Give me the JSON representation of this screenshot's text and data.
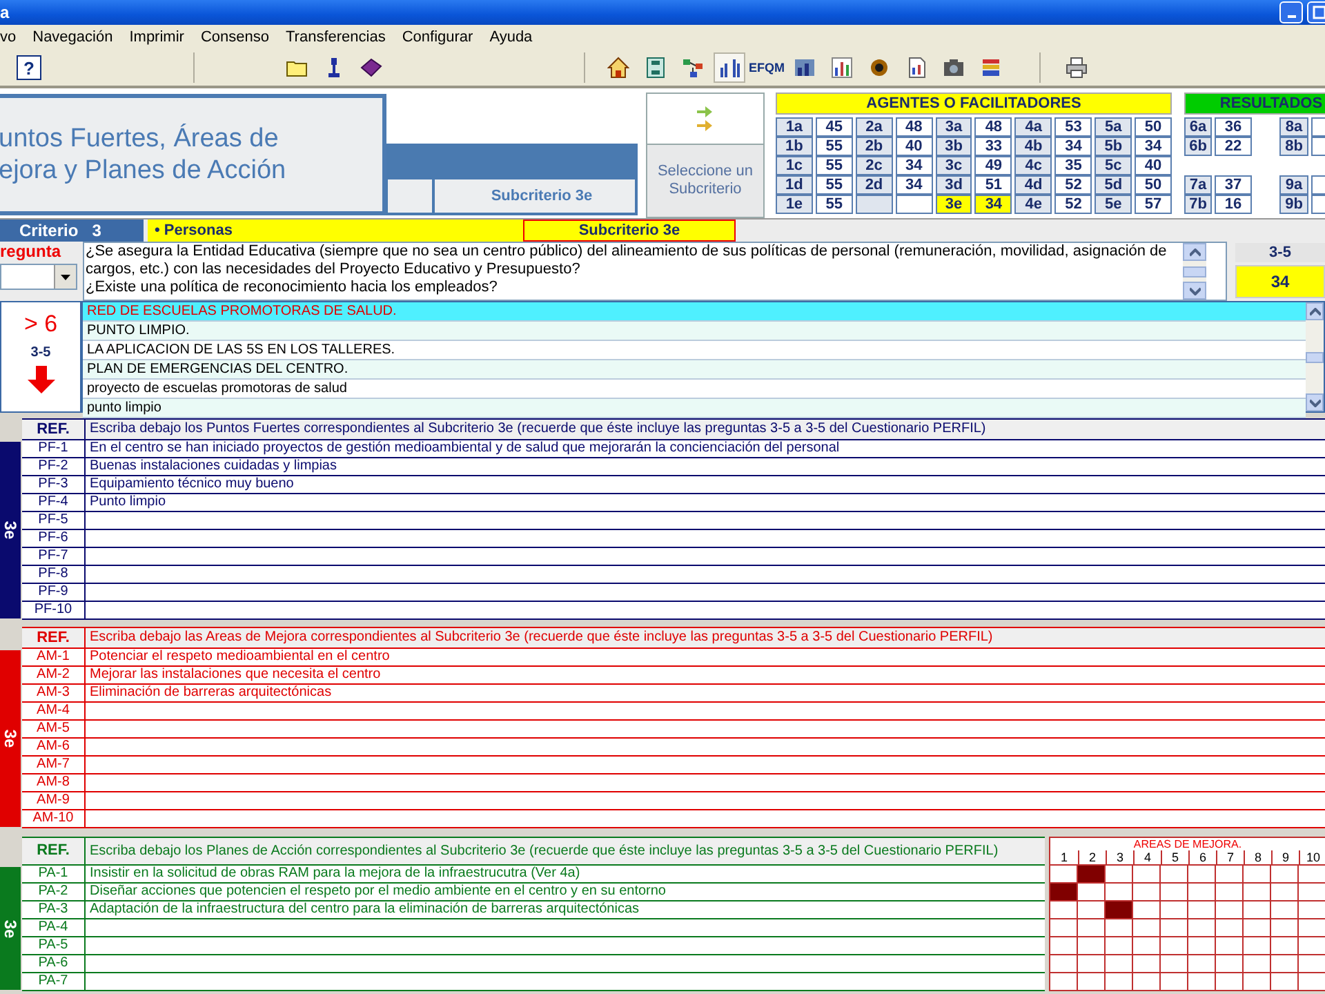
{
  "window": {
    "title": "a"
  },
  "menu": [
    "vo",
    "Navegación",
    "Imprimir",
    "Consenso",
    "Transferencias",
    "Configurar",
    "Ayuda"
  ],
  "toolbar": [
    [
      {
        "kind": "text",
        "label": "?",
        "pressed": false
      }
    ],
    [
      {
        "kind": "folder",
        "pressed": false
      },
      {
        "kind": "figure",
        "pressed": false
      },
      {
        "kind": "book",
        "pressed": false
      }
    ],
    [
      {
        "kind": "home",
        "pressed": false
      },
      {
        "kind": "list",
        "pressed": false
      },
      {
        "kind": "network",
        "pressed": false
      },
      {
        "kind": "bars",
        "pressed": true
      },
      {
        "kind": "text",
        "label": "EFQM",
        "pressed": false
      },
      {
        "kind": "gridchart",
        "pressed": false
      },
      {
        "kind": "barchart",
        "pressed": false
      },
      {
        "kind": "target",
        "pressed": false
      },
      {
        "kind": "document",
        "pressed": false
      },
      {
        "kind": "camera",
        "pressed": false
      },
      {
        "kind": "stack",
        "pressed": false
      }
    ],
    [
      {
        "kind": "printer",
        "pressed": false
      }
    ]
  ],
  "header": {
    "title_lines": [
      "untos Fuertes, Áreas de",
      "ejora y Planes de Acción"
    ],
    "subcriterion": "Subcriterio 3e"
  },
  "selector": {
    "label": "Seleccione un Subcriterio"
  },
  "agentes": {
    "title": "AGENTES O FACILITADORES",
    "rows": [
      [
        {
          "kind": "item",
          "code": "1a",
          "value": "45",
          "selected": false
        },
        {
          "kind": "item",
          "code": "2a",
          "value": "48",
          "selected": false
        },
        {
          "kind": "item",
          "code": "3a",
          "value": "48",
          "selected": false
        },
        {
          "kind": "item",
          "code": "4a",
          "value": "53",
          "selected": false
        },
        {
          "kind": "item",
          "code": "5a",
          "value": "50",
          "selected": false
        }
      ],
      [
        {
          "kind": "item",
          "code": "1b",
          "value": "55",
          "selected": false
        },
        {
          "kind": "item",
          "code": "2b",
          "value": "40",
          "selected": false
        },
        {
          "kind": "item",
          "code": "3b",
          "value": "33",
          "selected": false
        },
        {
          "kind": "item",
          "code": "4b",
          "value": "34",
          "selected": false
        },
        {
          "kind": "item",
          "code": "5b",
          "value": "34",
          "selected": false
        }
      ],
      [
        {
          "kind": "item",
          "code": "1c",
          "value": "55",
          "selected": false
        },
        {
          "kind": "item",
          "code": "2c",
          "value": "34",
          "selected": false
        },
        {
          "kind": "item",
          "code": "3c",
          "value": "49",
          "selected": false
        },
        {
          "kind": "item",
          "code": "4c",
          "value": "35",
          "selected": false
        },
        {
          "kind": "item",
          "code": "5c",
          "value": "40",
          "selected": false
        }
      ],
      [
        {
          "kind": "item",
          "code": "1d",
          "value": "55",
          "selected": false
        },
        {
          "kind": "item",
          "code": "2d",
          "value": "34",
          "selected": false
        },
        {
          "kind": "item",
          "code": "3d",
          "value": "51",
          "selected": false
        },
        {
          "kind": "item",
          "code": "4d",
          "value": "52",
          "selected": false
        },
        {
          "kind": "item",
          "code": "5d",
          "value": "50",
          "selected": false
        }
      ],
      [
        {
          "kind": "item",
          "code": "1e",
          "value": "55",
          "selected": false
        },
        {
          "kind": "blank"
        },
        {
          "kind": "item",
          "code": "3e",
          "value": "34",
          "selected": true
        },
        {
          "kind": "item",
          "code": "4e",
          "value": "52",
          "selected": false
        },
        {
          "kind": "item",
          "code": "5e",
          "value": "57",
          "selected": false
        }
      ]
    ]
  },
  "resultados": {
    "title": "RESULTADOS",
    "rows": [
      {
        "kind": "cells",
        "cells": [
          {
            "code": "6a",
            "value": "36",
            "selected": false
          },
          {
            "code": "8a",
            "selected": false
          }
        ]
      },
      {
        "kind": "cells",
        "cells": [
          {
            "code": "6b",
            "value": "22",
            "selected": false
          },
          {
            "code": "8b",
            "selected": false
          }
        ]
      },
      {
        "kind": "gap"
      },
      {
        "kind": "cells",
        "cells": [
          {
            "code": "7a",
            "value": "37",
            "selected": false
          },
          {
            "code": "9a",
            "selected": false
          }
        ]
      },
      {
        "kind": "cells",
        "cells": [
          {
            "code": "7b",
            "value": "16",
            "selected": false
          },
          {
            "code": "9b",
            "selected": false
          }
        ]
      }
    ]
  },
  "criterion": {
    "label": "Criterio",
    "number": "3",
    "name": "• Personas",
    "subcriterion": "Subcriterio 3e"
  },
  "question": {
    "label": "regunta",
    "questions": [
      "¿Se asegura la Entidad Educativa (siempre que no sea un centro público) del alineamiento de sus políticas de personal (remuneración, movilidad, asignación de cargos, etc.) con las necesidades del Proyecto Educativo y Presupuesto?",
      "¿Existe una política de reconocimiento hacia los empleados?"
    ],
    "range": "3-5",
    "score": "34"
  },
  "evidence": {
    "badge": "> 6",
    "range": "3-5",
    "items": [
      {
        "text": "RED DE ESCUELAS PROMOTORAS DE SALUD.",
        "selected": true
      },
      {
        "text": "PUNTO LIMPIO.",
        "selected": false
      },
      {
        "text": "LA APLICACION DE LAS 5S EN LOS TALLERES.",
        "selected": false
      },
      {
        "text": "PLAN DE EMERGENCIAS DEL CENTRO.",
        "selected": false
      },
      {
        "text": "proyecto de escuelas promotoras de salud",
        "selected": false
      },
      {
        "text": "punto limpio",
        "selected": false
      }
    ]
  },
  "sections": [
    {
      "kind": "plain",
      "color": "#0a0a6e",
      "strip": "3e",
      "ref": "REF.",
      "description": "Escriba debajo los Puntos Fuertes correspondientes al Subcriterio 3e (recuerde que éste incluye las preguntas 3-5 a 3-5 del Cuestionario PERFIL)",
      "rows": [
        {
          "ref": "PF-1",
          "text": "En el centro se han iniciado proyectos de gestión medioambiental y de salud que mejorarán la concienciación del personal"
        },
        {
          "ref": "PF-2",
          "text": "Buenas instalaciones cuidadas y limpias"
        },
        {
          "ref": "PF-3",
          "text": "Equipamiento técnico muy bueno"
        },
        {
          "ref": "PF-4",
          "text": "Punto limpio"
        },
        {
          "ref": "PF-5"
        },
        {
          "ref": "PF-6"
        },
        {
          "ref": "PF-7"
        },
        {
          "ref": "PF-8"
        },
        {
          "ref": "PF-9"
        },
        {
          "ref": "PF-10"
        }
      ]
    },
    {
      "kind": "plain",
      "color": "#e00000",
      "strip": "3e",
      "ref": "REF.",
      "description": "Escriba debajo las Areas de Mejora correspondientes al Subcriterio 3e (recuerde que éste incluye las preguntas 3-5 a 3-5 del Cuestionario PERFIL)",
      "rows": [
        {
          "ref": "AM-1",
          "text": "Potenciar el respeto medioambiental en el centro"
        },
        {
          "ref": "AM-2",
          "text": "Mejorar las instalaciones que necesita el centro"
        },
        {
          "ref": "AM-3",
          "text": "Eliminación de barreras arquitectónicas"
        },
        {
          "ref": "AM-4"
        },
        {
          "ref": "AM-5"
        },
        {
          "ref": "AM-6"
        },
        {
          "ref": "AM-7"
        },
        {
          "ref": "AM-8"
        },
        {
          "ref": "AM-9"
        },
        {
          "ref": "AM-10"
        }
      ]
    },
    {
      "kind": "matrix",
      "color": "#0a7a1e",
      "strip": "3e",
      "ref": "REF.",
      "description": "Escriba debajo los Planes de Acción correspondientes al Subcriterio 3e (recuerde que éste incluye las preguntas 3-5 a 3-5 del Cuestionario PERFIL)",
      "matrix": {
        "title": "AREAS DE MEJORA.",
        "columns": [
          "1",
          "2",
          "3",
          "4",
          "5",
          "6",
          "7",
          "8",
          "9",
          "10"
        ]
      },
      "rows": [
        {
          "ref": "PA-1",
          "text": "Insistir en la solicitud de obras RAM para la mejora de la infraestrucutra (Ver 4a)",
          "marks": [
            false,
            true,
            false,
            false,
            false,
            false,
            false,
            false,
            false,
            false
          ]
        },
        {
          "ref": "PA-2",
          "text": "Diseñar acciones que potencien el respeto por el medio ambiente en el centro y en su entorno",
          "marks": [
            true,
            false,
            false,
            false,
            false,
            false,
            false,
            false,
            false,
            false
          ]
        },
        {
          "ref": "PA-3",
          "text": "Adaptación de la infraestructura del centro para la eliminación de barreras arquitectónicas",
          "marks": [
            false,
            false,
            true,
            false,
            false,
            false,
            false,
            false,
            false,
            false
          ]
        },
        {
          "ref": "PA-4",
          "marks": [
            false,
            false,
            false,
            false,
            false,
            false,
            false,
            false,
            false,
            false
          ]
        },
        {
          "ref": "PA-5",
          "marks": [
            false,
            false,
            false,
            false,
            false,
            false,
            false,
            false,
            false,
            false
          ]
        },
        {
          "ref": "PA-6",
          "marks": [
            false,
            false,
            false,
            false,
            false,
            false,
            false,
            false,
            false,
            false
          ]
        },
        {
          "ref": "PA-7",
          "marks": [
            false,
            false,
            false,
            false,
            false,
            false,
            false,
            false,
            false,
            false
          ]
        }
      ]
    }
  ]
}
